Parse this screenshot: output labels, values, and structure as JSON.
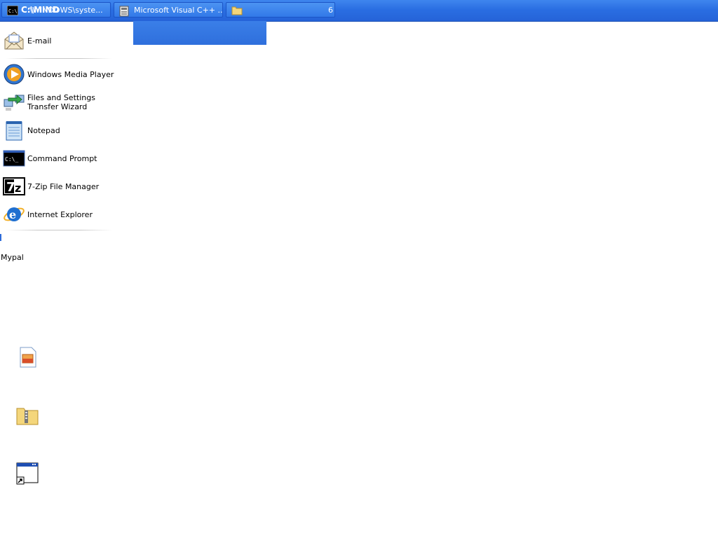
{
  "taskbar": {
    "buttons": [
      {
        "label": "C:\\WINDOWS\\syste...",
        "icon": "cmd-icon"
      },
      {
        "label": "Microsoft Visual C++ ...",
        "icon": "visual-cpp-icon"
      },
      {
        "label": "",
        "icon": "folder-icon"
      }
    ],
    "overlay_title": "C:\\MIND",
    "folder_count": "6"
  },
  "start_menu": {
    "items": [
      {
        "label": "E-mail",
        "icon": "email-icon"
      },
      {
        "label": "Windows Media Player",
        "icon": "media-player-icon"
      },
      {
        "label": "Files and Settings Transfer Wizard",
        "icon": "transfer-wizard-icon"
      },
      {
        "label": "Notepad",
        "icon": "notepad-icon"
      },
      {
        "label": "Command Prompt",
        "icon": "command-prompt-icon"
      },
      {
        "label": "7-Zip File Manager",
        "icon": "7zip-icon"
      },
      {
        "label": "Internet Explorer",
        "icon": "internet-explorer-icon"
      }
    ]
  },
  "desktop": {
    "label": "Mypal",
    "icons": [
      "image-file-icon",
      "zip-folder-icon",
      "window-shortcut-icon"
    ]
  },
  "colors": {
    "taskbar_blue": "#2a6ee2",
    "button_blue": "#3279e8"
  }
}
